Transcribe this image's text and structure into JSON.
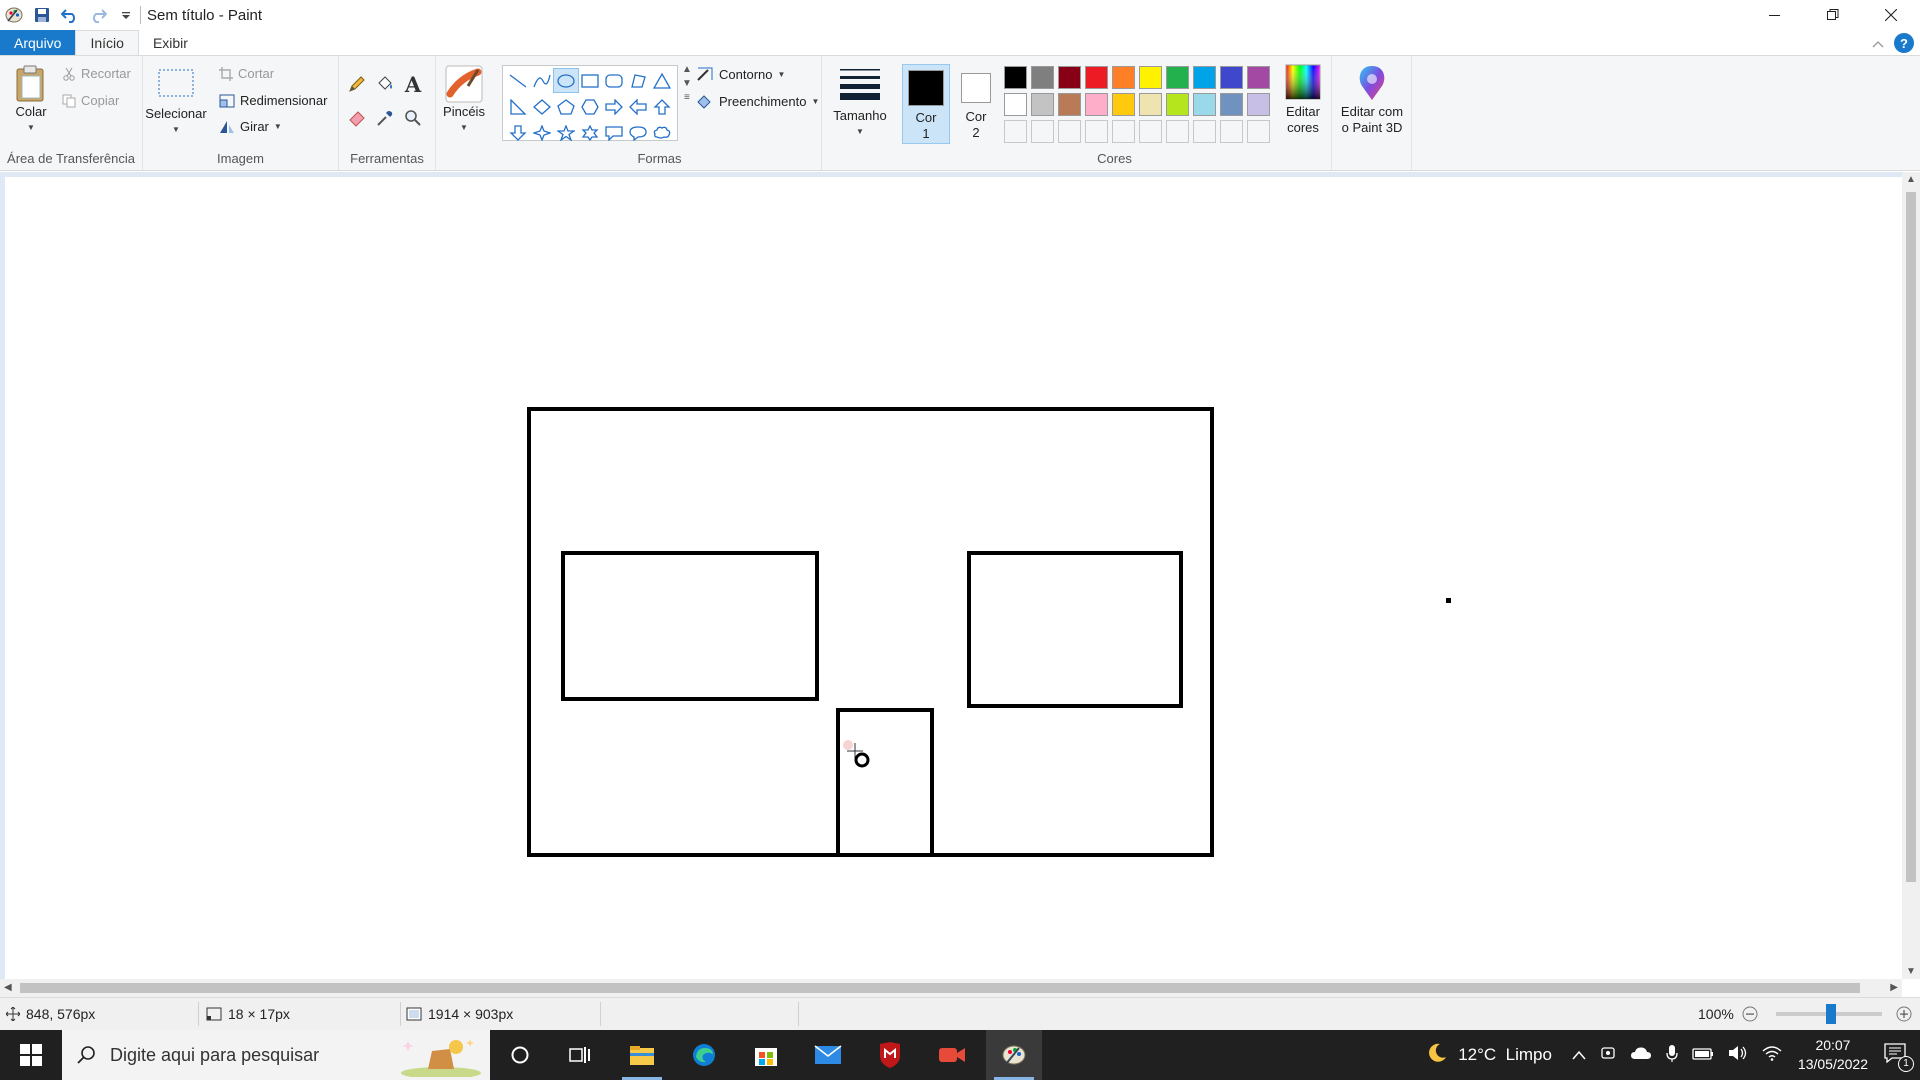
{
  "window": {
    "title": "Sem título - Paint",
    "controls": [
      "minimize-icon",
      "restore-icon",
      "close-icon"
    ]
  },
  "tabs": [
    {
      "label": "Arquivo"
    },
    {
      "label": "Início"
    },
    {
      "label": "Exibir"
    }
  ],
  "ribbon": {
    "clipboard": {
      "paste": "Colar",
      "cut": "Recortar",
      "copy": "Copiar",
      "group": "Área de Transferência"
    },
    "image": {
      "select": "Selecionar",
      "crop": "Cortar",
      "resize": "Redimensionar",
      "rotate": "Girar",
      "group": "Imagem"
    },
    "tools": {
      "group": "Ferramentas",
      "items": [
        "pencil-icon",
        "fill-icon",
        "text-icon",
        "eraser-icon",
        "color-picker-icon",
        "magnifier-icon"
      ]
    },
    "brushes": {
      "label": "Pincéis"
    },
    "shapes": {
      "outline": "Contorno",
      "fill": "Preenchimento",
      "group": "Formas",
      "selected": "oval"
    },
    "size": {
      "label": "Tamanho"
    },
    "colors": {
      "color1_label": "Cor",
      "color1_num": "1",
      "color2_label": "Cor",
      "color2_num": "2",
      "color1": "#000000",
      "color2": "#ffffff",
      "edit_label_1": "Editar",
      "edit_label_2": "cores",
      "group": "Cores",
      "palette_row1": [
        "#000000",
        "#7f7f7f",
        "#880015",
        "#ed1c24",
        "#ff7f27",
        "#fff200",
        "#22b14c",
        "#00a2e8",
        "#3f48cc",
        "#a349a4"
      ],
      "palette_row2": [
        "#ffffff",
        "#c3c3c3",
        "#b97a57",
        "#ffaec9",
        "#ffc90e",
        "#efe4b0",
        "#b5e61d",
        "#99d9ea",
        "#7092be",
        "#c8bfe7"
      ]
    },
    "paint3d": {
      "line1": "Editar com",
      "line2": "o Paint 3D"
    }
  },
  "status": {
    "cursor_pos": "848, 576px",
    "selection_size": "18 × 17px",
    "canvas_size": "1914 × 903px",
    "zoom": "100%"
  },
  "taskbar": {
    "search_placeholder": "Digite aqui para pesquisar",
    "weather": "12°C  Limpo",
    "time": "20:07",
    "date": "13/05/2022",
    "notif_count": "1"
  }
}
